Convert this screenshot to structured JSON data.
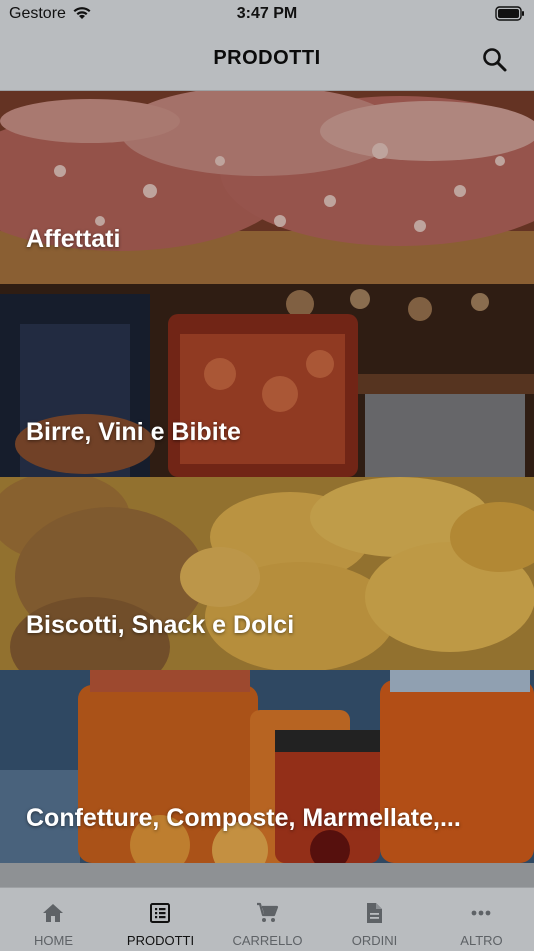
{
  "status_bar": {
    "carrier": "Gestore",
    "time": "3:47 PM",
    "icons": [
      "wifi-icon",
      "battery-icon"
    ]
  },
  "header": {
    "title": "PRODOTTI",
    "search_icon": "search-icon"
  },
  "categories": [
    {
      "label": "Affettati",
      "image": "salami-image"
    },
    {
      "label": "Birre, Vini e Bibite",
      "image": "drinks-image"
    },
    {
      "label": "Biscotti, Snack e Dolci",
      "image": "snacks-image"
    },
    {
      "label": "Confetture, Composte, Marmellate,...",
      "image": "jams-image"
    }
  ],
  "tabs": [
    {
      "label": "HOME",
      "icon": "home-icon",
      "active": false
    },
    {
      "label": "PRODOTTI",
      "icon": "list-icon",
      "active": true
    },
    {
      "label": "CARRELLO",
      "icon": "cart-icon",
      "active": false
    },
    {
      "label": "ORDINI",
      "icon": "document-icon",
      "active": false
    },
    {
      "label": "ALTRO",
      "icon": "more-icon",
      "active": false
    }
  ],
  "colors": {
    "background": "#b9bcbf",
    "active_tab": "#111111",
    "inactive_tab": "#5e6266"
  }
}
